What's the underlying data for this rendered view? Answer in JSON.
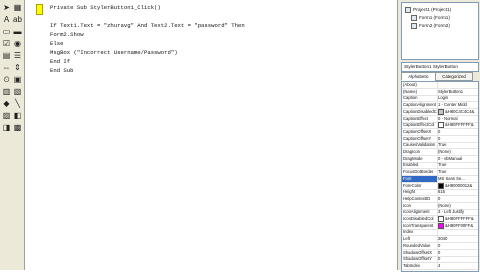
{
  "toolbox": {
    "tools": [
      {
        "name": "pointer-icon",
        "glyph": "➤"
      },
      {
        "name": "picturebox-icon",
        "glyph": "▦"
      },
      {
        "name": "label-icon",
        "glyph": "A"
      },
      {
        "name": "textbox-icon",
        "glyph": "ab"
      },
      {
        "name": "frame-icon",
        "glyph": "▭"
      },
      {
        "name": "commandbutton-icon",
        "glyph": "▬"
      },
      {
        "name": "checkbox-icon",
        "glyph": "☑"
      },
      {
        "name": "optionbutton-icon",
        "glyph": "◉"
      },
      {
        "name": "combobox-icon",
        "glyph": "▤"
      },
      {
        "name": "listbox-icon",
        "glyph": "☰"
      },
      {
        "name": "hscrollbar-icon",
        "glyph": "⇔"
      },
      {
        "name": "vscrollbar-icon",
        "glyph": "⇕"
      },
      {
        "name": "timer-icon",
        "glyph": "⏲"
      },
      {
        "name": "drivelist-icon",
        "glyph": "▣"
      },
      {
        "name": "dirlist-icon",
        "glyph": "▥"
      },
      {
        "name": "filelist-icon",
        "glyph": "▧"
      },
      {
        "name": "shape-icon",
        "glyph": "◆"
      },
      {
        "name": "line-icon",
        "glyph": "╲"
      },
      {
        "name": "image-icon",
        "glyph": "▨"
      },
      {
        "name": "data-icon",
        "glyph": "◧"
      },
      {
        "name": "ole-icon",
        "glyph": "◨"
      },
      {
        "name": "custom-icon",
        "glyph": "▩"
      }
    ]
  },
  "editor": {
    "lines": [
      "Private Sub StylerButton1_Click()",
      "",
      "If Text1.Text = \"zhuravg\" And Text2.Text = \"password\" Then",
      "Form2.Show",
      "Else",
      "MsgBox (\"Incorrect Username/Password\")",
      "End If",
      "End Sub"
    ]
  },
  "project": {
    "items": [
      "Project1 (Project1)",
      "Form1 (Form1)",
      "Form2 (Form2)"
    ]
  },
  "properties": {
    "object": "StylerButton1  StylerButton",
    "tabs": [
      "Alphabetic",
      "Categorized"
    ],
    "rows": [
      {
        "name": "(About)",
        "value": ""
      },
      {
        "name": "(Name)",
        "value": "StylerButton1"
      },
      {
        "name": "Caption",
        "value": "Login"
      },
      {
        "name": "CaptionAlignment",
        "value": "1 - Center Midd"
      },
      {
        "name": "CaptionDisabledCol",
        "value": "&H80C4C4C4&",
        "swatch": "#c4c4c4"
      },
      {
        "name": "CaptionEffect",
        "value": "0 - Normal"
      },
      {
        "name": "CaptionEffectCol",
        "value": "&H80FFFFFF&",
        "swatch": "#ffffff"
      },
      {
        "name": "CaptionOffsetX",
        "value": "0"
      },
      {
        "name": "CaptionOffsetY",
        "value": "0"
      },
      {
        "name": "CausesValidation",
        "value": "True"
      },
      {
        "name": "DragIcon",
        "value": "(None)"
      },
      {
        "name": "DragMode",
        "value": "0 - vbManual"
      },
      {
        "name": "Enabled",
        "value": "True"
      },
      {
        "name": "FocusDotBorder",
        "value": "True"
      },
      {
        "name": "Font",
        "value": "MS Sans Se...",
        "selected": true
      },
      {
        "name": "ForeColor",
        "value": "&H80000012&",
        "swatch": "#000000"
      },
      {
        "name": "Height",
        "value": "615"
      },
      {
        "name": "HelpContextID",
        "value": "0"
      },
      {
        "name": "Icon",
        "value": "(None)"
      },
      {
        "name": "IconAlignment",
        "value": "3 - Left Justify"
      },
      {
        "name": "IconDisabledCol",
        "value": "&H80FFFFFF&",
        "swatch": "#ffffff"
      },
      {
        "name": "IconTransparent",
        "value": "&H80FF00FF&",
        "swatch": "#ff00ff"
      },
      {
        "name": "Index",
        "value": ""
      },
      {
        "name": "Left",
        "value": "2040"
      },
      {
        "name": "RoundedValue",
        "value": "0"
      },
      {
        "name": "ShadowOffsetX",
        "value": "0"
      },
      {
        "name": "ShadowOffsetY",
        "value": "0"
      },
      {
        "name": "TabIndex",
        "value": "4"
      }
    ]
  },
  "colors": {
    "editor_marker": "#ffff00",
    "selection": "#316ac5",
    "chrome": "#ece9d8"
  }
}
